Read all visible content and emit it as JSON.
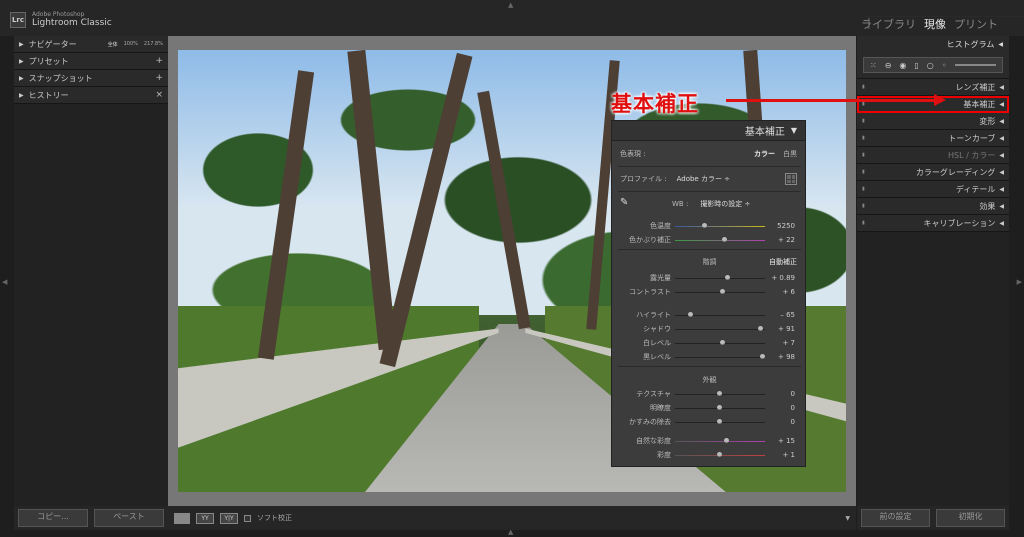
{
  "app": {
    "vendor": "Adobe Photoshop",
    "name": "Lightroom Classic",
    "logo": "Lrc"
  },
  "modules": [
    "ライブラリ",
    "現像",
    "プリント"
  ],
  "left_panel": {
    "navigator": {
      "label": "ナビゲーター",
      "fit": "全体",
      "zoom1": "100%",
      "zoom2": "217.8%"
    },
    "presets": {
      "label": "プリセット",
      "action": "+"
    },
    "snapshots": {
      "label": "スナップショット",
      "action": "+"
    },
    "history": {
      "label": "ヒストリー",
      "action": "×"
    },
    "copy_button": "コピー...",
    "paste_button": "ペースト"
  },
  "toolbar": {
    "view1": "YY",
    "view2": "Y|Y",
    "softproof": "ソフト校正"
  },
  "right_panel": {
    "histogram": "ヒストグラム",
    "panels": [
      {
        "label": "レンズ補正"
      },
      {
        "label": "基本補正"
      },
      {
        "label": "変形"
      },
      {
        "label": "トーンカーブ"
      },
      {
        "label": "HSL / カラー"
      },
      {
        "label": "カラーグレーディング"
      },
      {
        "label": "ディテール"
      },
      {
        "label": "効果"
      },
      {
        "label": "キャリブレーション"
      }
    ],
    "prev_button": "前の設定",
    "reset_button": "初期化"
  },
  "basic_panel": {
    "title": "基本補正",
    "treatment_label": "色表現 :",
    "color": "カラー",
    "bw": "白黒",
    "profile_label": "プロファイル :",
    "profile_value": "Adobe カラー ÷",
    "wb_label": "WB :",
    "wb_value": "撮影時の設定 ÷",
    "tone_title": "階調",
    "auto": "自動補正",
    "presence_title": "外観",
    "sliders": [
      {
        "label": "色温度",
        "value": "5250",
        "pos": 0.33
      },
      {
        "label": "色かぶり補正",
        "value": "+ 22",
        "pos": 0.56
      },
      {
        "label": "露光量",
        "value": "+ 0.89",
        "pos": 0.59
      },
      {
        "label": "コントラスト",
        "value": "+ 6",
        "pos": 0.53
      },
      {
        "label": "ハイライト",
        "value": "– 65",
        "pos": 0.18
      },
      {
        "label": "シャドウ",
        "value": "+ 91",
        "pos": 0.95
      },
      {
        "label": "白レベル",
        "value": "+ 7",
        "pos": 0.53
      },
      {
        "label": "黒レベル",
        "value": "+ 98",
        "pos": 0.98
      },
      {
        "label": "テクスチャ",
        "value": "0",
        "pos": 0.5
      },
      {
        "label": "明瞭度",
        "value": "0",
        "pos": 0.5
      },
      {
        "label": "かすみの除去",
        "value": "0",
        "pos": 0.5
      },
      {
        "label": "自然な彩度",
        "value": "+ 15",
        "pos": 0.58
      },
      {
        "label": "彩度",
        "value": "+ 1",
        "pos": 0.5
      }
    ]
  },
  "annotation": {
    "text": "基本補正",
    "color": "#e01010"
  }
}
